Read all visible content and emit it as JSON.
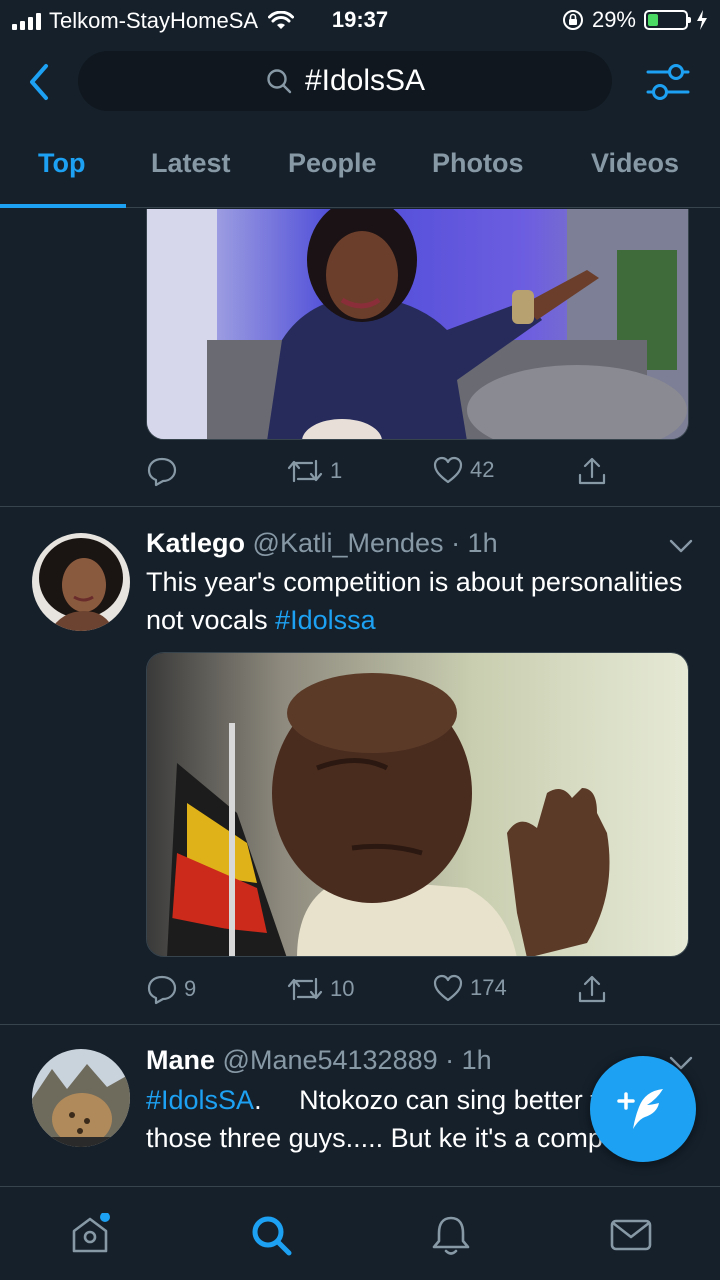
{
  "status_bar": {
    "carrier": "Telkom-StayHomeSA",
    "time": "19:37",
    "battery": "29%",
    "battery_level": 0.29
  },
  "search": {
    "query": "#IdolsSA"
  },
  "tabs": [
    {
      "label": "Top",
      "active": true
    },
    {
      "label": "Latest",
      "active": false
    },
    {
      "label": "People",
      "active": false
    },
    {
      "label": "Photos",
      "active": false
    },
    {
      "label": "Videos",
      "active": false
    }
  ],
  "tweets": [
    {
      "replies": "",
      "retweets": "1",
      "likes": "42"
    },
    {
      "name": "Katlego",
      "handle": "@Katli_Mendes",
      "time": "· 1h",
      "text": "This year's competition is about personalities not vocals ",
      "hashtag": "#Idolssa",
      "replies": "9",
      "retweets": "10",
      "likes": "174"
    },
    {
      "name": "Mane",
      "handle": "@Mane54132889",
      "time": "· 1h",
      "hashtag": "#IdolsSA",
      "text": ".     Ntokozo can sing better than those three guys..... But ke it's a competition"
    }
  ],
  "colors": {
    "background": "#15202b",
    "accent": "#1da1f2",
    "muted": "#8899a6",
    "border": "#38444d"
  },
  "icons": [
    "back-arrow-icon",
    "search-icon",
    "filter-icon",
    "reply-icon",
    "retweet-icon",
    "like-icon",
    "share-icon",
    "chevron-down-icon",
    "compose-icon",
    "home-icon",
    "explore-search-icon",
    "notifications-icon",
    "messages-icon"
  ]
}
